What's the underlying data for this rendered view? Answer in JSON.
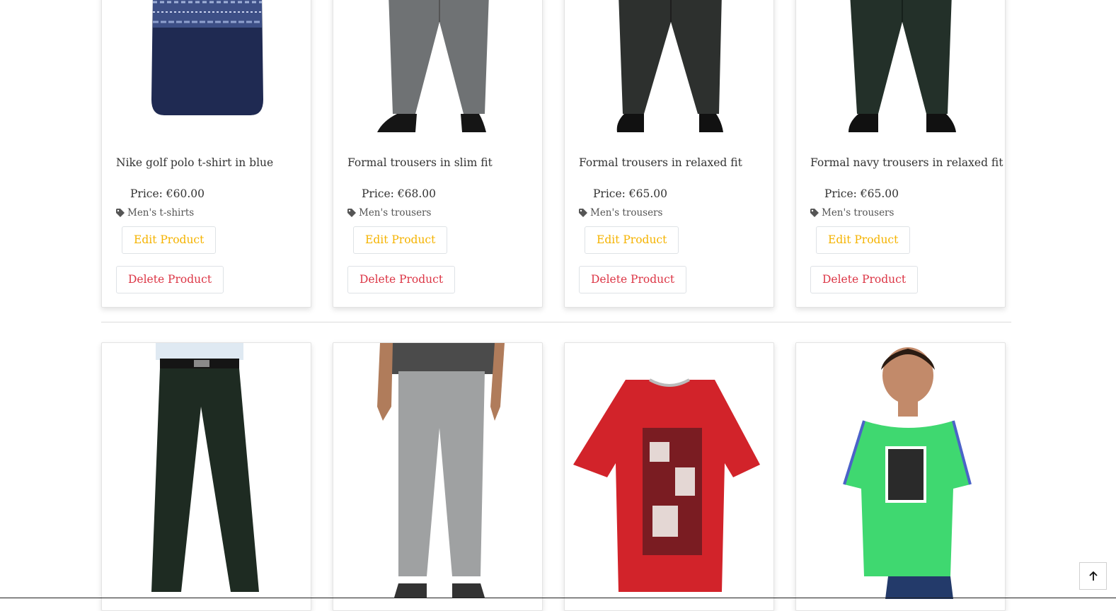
{
  "top_products": [
    {
      "name": "Nike golf polo t-shirt in blue",
      "price": "Price: €60.00",
      "category": "Men's t-shirts",
      "edit_label": "Edit Product",
      "delete_label": "Delete Product"
    },
    {
      "name": "Formal trousers in slim fit",
      "price": "Price: €68.00",
      "category": "Men's trousers",
      "edit_label": "Edit Product",
      "delete_label": "Delete Product"
    },
    {
      "name": "Formal trousers in relaxed fit",
      "price": "Price: €65.00",
      "category": "Men's trousers",
      "edit_label": "Edit Product",
      "delete_label": "Delete Product"
    },
    {
      "name": "Formal navy trousers in relaxed fit",
      "price": "Price: €65.00",
      "category": "Men's trousers",
      "edit_label": "Edit Product",
      "delete_label": "Delete Product"
    }
  ],
  "bottom_products": [
    {
      "image": "dark-green-trousers"
    },
    {
      "image": "grey-sweatpants"
    },
    {
      "image": "red-graphic-tshirt"
    },
    {
      "image": "green-puma-tshirt"
    }
  ],
  "icons": {
    "tag": "tag-icon",
    "back_to_top": "arrow-up-icon"
  },
  "colors": {
    "edit": "#f5b300",
    "delete": "#dc3545",
    "muted": "#555555"
  }
}
